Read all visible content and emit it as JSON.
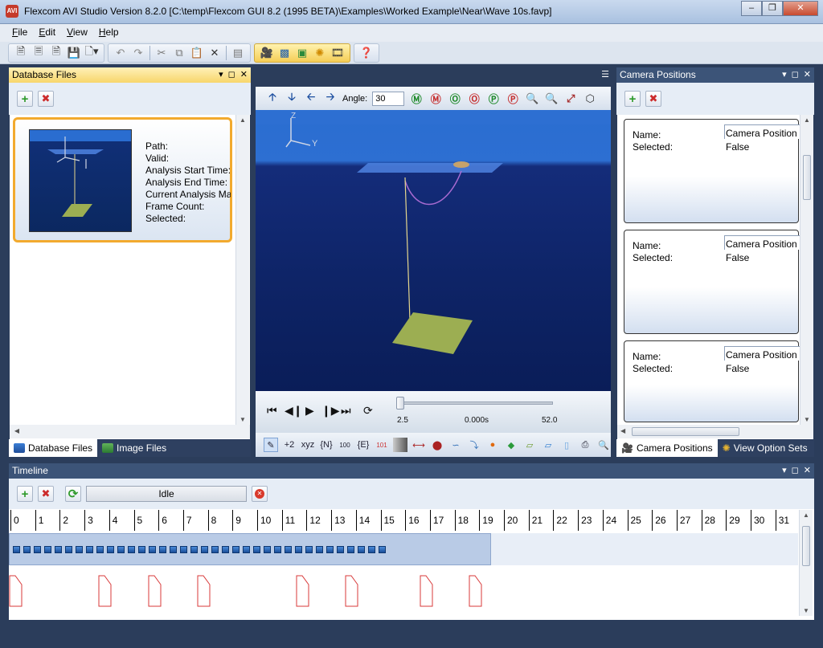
{
  "window": {
    "title": "Flexcom AVI Studio Version 8.2.0 [C:\\temp\\Flexcom GUI 8.2 (1995 BETA)\\Examples\\Worked Example\\Near\\Wave 10s.favp]",
    "app_icon_text": "AVI"
  },
  "menubar": {
    "items": [
      {
        "label": "File",
        "accel": "F",
        "rest": "ile"
      },
      {
        "label": "Edit",
        "accel": "E",
        "rest": "dit"
      },
      {
        "label": "View",
        "accel": "V",
        "rest": "iew"
      },
      {
        "label": "Help",
        "accel": "H",
        "rest": "elp"
      }
    ]
  },
  "database_panel": {
    "header": "Database Files",
    "card": {
      "props": [
        "Path:",
        "Valid:",
        "Analysis Start Time:",
        "Analysis End Time:",
        "Current Analysis Max",
        "Frame Count:",
        "Selected:"
      ]
    },
    "tabs": [
      {
        "label": "Database Files",
        "selected": true
      },
      {
        "label": "Image Files",
        "selected": false
      }
    ]
  },
  "viewport": {
    "angle_label": "Angle:",
    "angle_value": "30",
    "player": {
      "start": "2.5",
      "current": "0.000s",
      "end": "52.0"
    },
    "axis_labels": {
      "z": "Z",
      "y": "Y"
    }
  },
  "camera_panel": {
    "header": "Camera Positions",
    "cards": [
      {
        "name_label": "Name:",
        "name_value": "Camera Position",
        "selected_label": "Selected:",
        "selected_value": "False"
      },
      {
        "name_label": "Name:",
        "name_value": "Camera Position",
        "selected_label": "Selected:",
        "selected_value": "False"
      },
      {
        "name_label": "Name:",
        "name_value": "Camera Position",
        "selected_label": "Selected:",
        "selected_value": "False"
      }
    ],
    "tabs": [
      {
        "label": "Camera Positions",
        "selected": true
      },
      {
        "label": "View Option Sets",
        "selected": false
      }
    ]
  },
  "timeline": {
    "header": "Timeline",
    "status": "Idle",
    "ticks": [
      "0",
      "1",
      "2",
      "3",
      "4",
      "5",
      "6",
      "7",
      "8",
      "9",
      "10",
      "11",
      "12",
      "13",
      "14",
      "15",
      "16",
      "17",
      "18",
      "19",
      "20",
      "21",
      "22",
      "23",
      "24",
      "25",
      "26",
      "27",
      "28",
      "29",
      "30",
      "31"
    ],
    "keyframe_seconds": [
      0,
      2,
      4,
      6,
      10,
      12,
      15,
      17
    ]
  },
  "colors": {
    "panel_header_active": "#f7d66b",
    "panel_header": "#3c5478",
    "accent": "#f2aa2e",
    "sea": "#0e2467",
    "sky": "#2a6dd0",
    "platform": "#4d82e0",
    "seabed": "#9cae52"
  }
}
